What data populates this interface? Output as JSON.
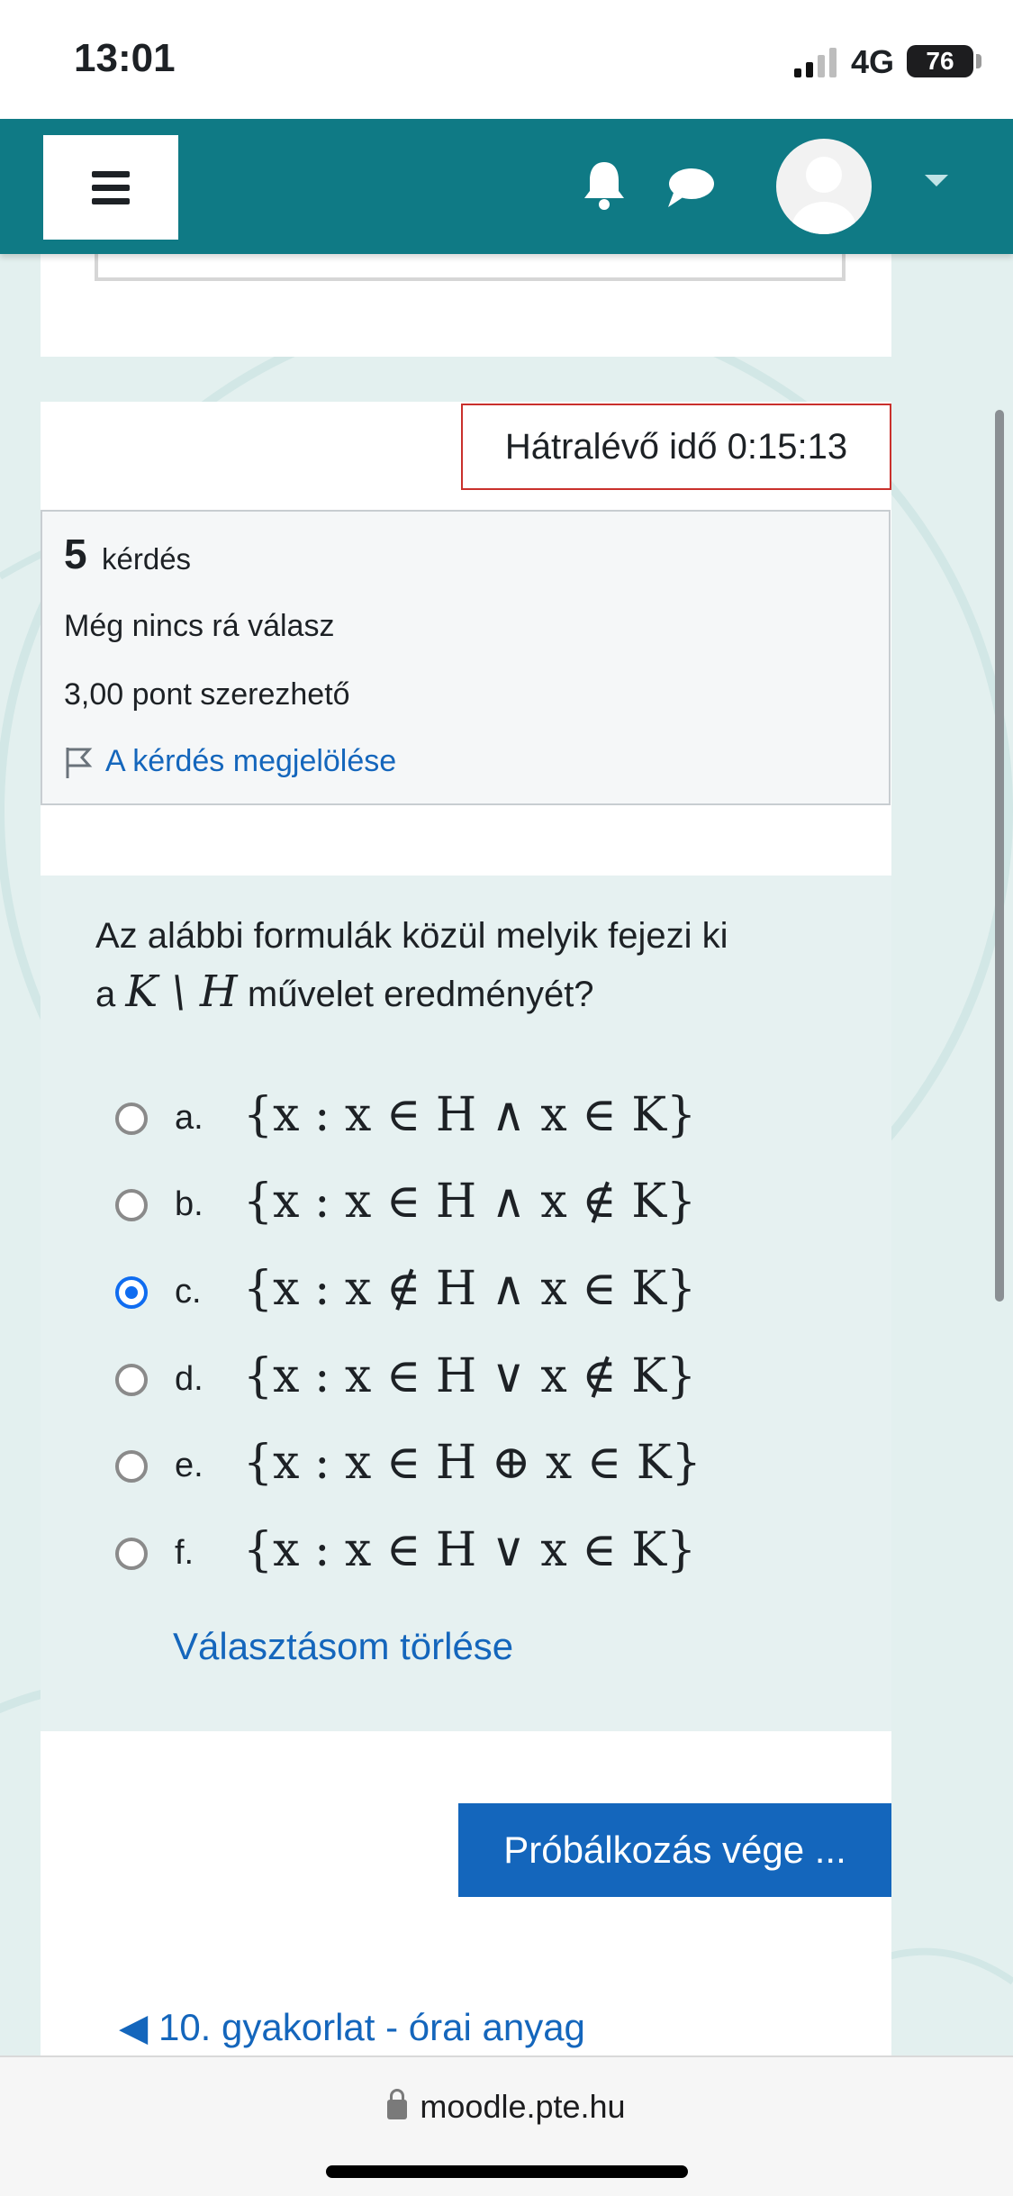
{
  "status_bar": {
    "time": "13:01",
    "network": "4G",
    "battery": "76"
  },
  "navbar": {
    "menu_icon": "hamburger-icon",
    "notifications_icon": "bell-icon",
    "messages_icon": "chat-bubble-icon",
    "user_icon": "user-avatar",
    "dropdown_icon": "caret-down-icon",
    "brand_color": "#0f7a85"
  },
  "quiz": {
    "timer": "Hátralévő idő 0:15:13",
    "question_number": "5",
    "question_label": "kérdés",
    "state": "Még nincs rá válasz",
    "grade": "3,00 pont szerezhető",
    "flag_label": "A kérdés megjelölése",
    "question_text_1": "Az alábbi formulák közül melyik fejezi ki",
    "question_text_2_prefix": "a",
    "question_math": "K \\ H",
    "question_text_2_suffix": "művelet eredményét?",
    "answers": [
      {
        "letter": "a.",
        "formula": "{x : x ∈ H ∧ x ∈ K}",
        "selected": false
      },
      {
        "letter": "b.",
        "formula": "{x : x ∈ H ∧ x ∉ K}",
        "selected": false
      },
      {
        "letter": "c.",
        "formula": "{x : x ∉ H ∧ x ∈ K}",
        "selected": true
      },
      {
        "letter": "d.",
        "formula": "{x : x ∈ H ∨ x ∉ K}",
        "selected": false
      },
      {
        "letter": "e.",
        "formula": "{x : x ∈ H ⊕ x ∈ K}",
        "selected": false
      },
      {
        "letter": "f.",
        "formula": "{x : x ∈ H ∨ x ∈ K}",
        "selected": false
      }
    ],
    "clear_choice": "Választásom törlése",
    "finish_button": "Próbálkozás vége ...",
    "prev_link": "◀ 10. gyakorlat - órai anyag",
    "accent_color": "#1466bc"
  },
  "browser": {
    "url": "moodle.pte.hu"
  }
}
